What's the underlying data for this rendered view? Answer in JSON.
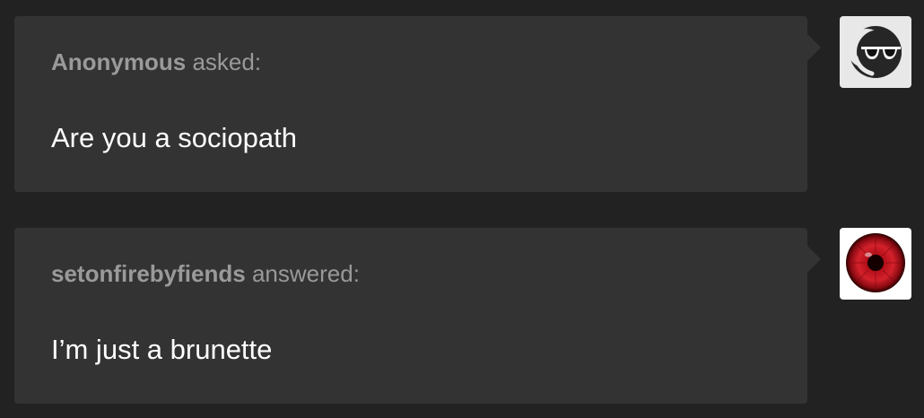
{
  "posts": [
    {
      "username": "Anonymous",
      "action": "asked:",
      "message": "Are you a sociopath",
      "avatar_icon": "anonymous-sunglasses-icon"
    },
    {
      "username": "setonfirebyfiends",
      "action": "answered:",
      "message": "I’m just a brunette",
      "avatar_icon": "red-eye-iris-icon"
    }
  ],
  "colors": {
    "background": "#222222",
    "bubble": "#333333",
    "header_text": "#999999",
    "message_text": "#ffffff"
  }
}
